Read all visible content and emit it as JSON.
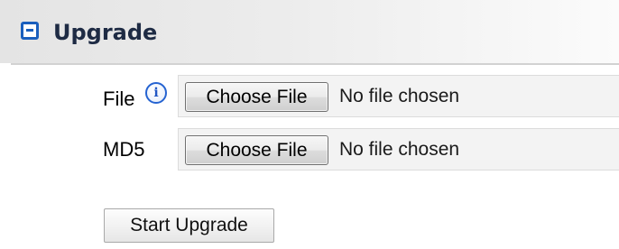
{
  "section": {
    "title": "Upgrade",
    "collapse_icon": "minus-square-icon",
    "accent_color": "#1a5fbd"
  },
  "form": {
    "fields": [
      {
        "label": "File",
        "help_icon": "info-icon",
        "help_glyph": "i",
        "button_label": "Choose File",
        "status": "No file chosen"
      },
      {
        "label": "MD5",
        "button_label": "Choose File",
        "status": "No file chosen"
      }
    ],
    "submit_label": "Start Upgrade"
  }
}
